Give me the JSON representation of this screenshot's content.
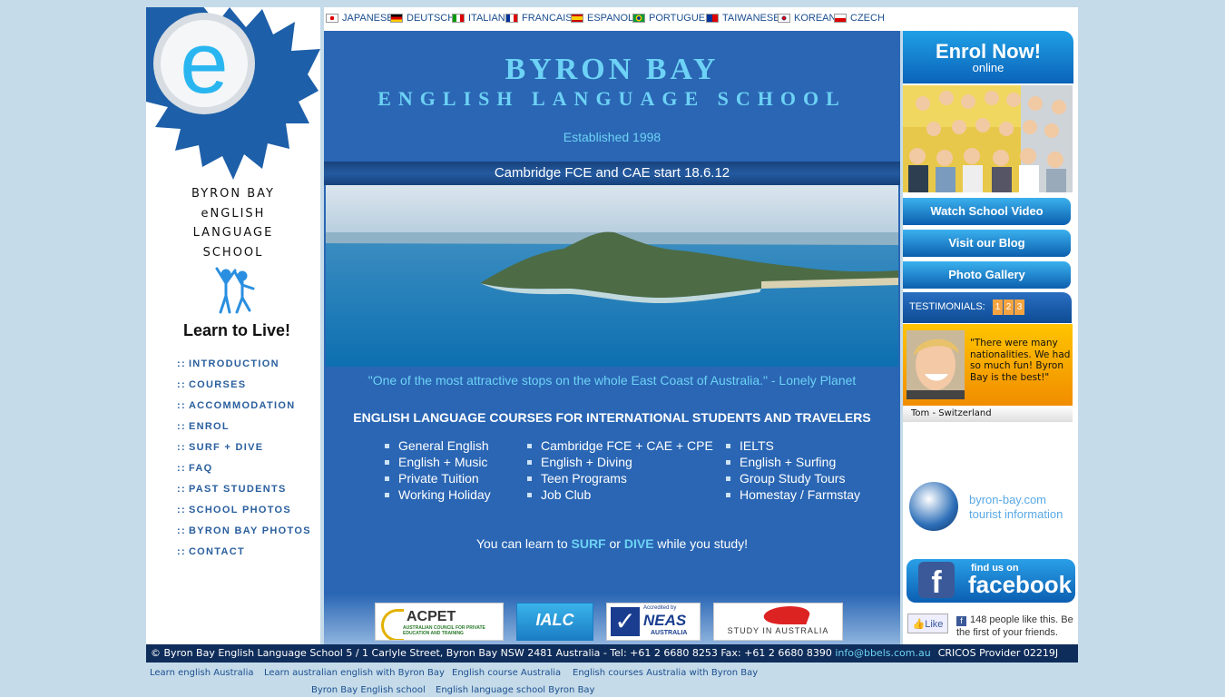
{
  "colors": {
    "accent": "#2a66b4",
    "title": "#6dd2f5",
    "nav": "#2a5f9e",
    "background": "#c5dbe9",
    "footer": "#0f2d5a"
  },
  "logo": {
    "name_lines": [
      "BYRON BAY",
      "eNGLISH",
      "LANGUAGE",
      "SCHOOL"
    ],
    "tagline": "Learn to Live!"
  },
  "nav": {
    "prefix": "::",
    "items": [
      "INTRODUCTION",
      "COURSES",
      "ACCOMMODATION",
      "ENROL",
      "SURF + DIVE",
      "FAQ",
      "PAST STUDENTS",
      "SCHOOL PHOTOS",
      "BYRON BAY PHOTOS",
      "CONTACT"
    ]
  },
  "languages": [
    {
      "label": "JAPANESE",
      "flag": "japan-flag-icon"
    },
    {
      "label": "DEUTSCH",
      "flag": "germany-flag-icon"
    },
    {
      "label": "ITALIAN",
      "flag": "italy-flag-icon"
    },
    {
      "label": "FRANCAIS",
      "flag": "france-flag-icon"
    },
    {
      "label": "ESPANOL",
      "flag": "spain-flag-icon"
    },
    {
      "label": "PORTUGUES",
      "flag": "brazil-flag-icon"
    },
    {
      "label": "TAIWANESE",
      "flag": "taiwan-flag-icon"
    },
    {
      "label": "KOREAN",
      "flag": "korea-flag-icon"
    },
    {
      "label": "CZECH",
      "flag": "czech-flag-icon"
    }
  ],
  "main": {
    "title": "BYRON BAY",
    "subtitle": "ENGLISH LANGUAGE SCHOOL",
    "established": "Established 1998",
    "banner": "Cambridge FCE and CAE start 18.6.12",
    "quote": "\"One of the most attractive stops on the whole East Coast of Australia.\" - Lonely Planet",
    "courses_heading": "ENGLISH LANGUAGE COURSES FOR INTERNATIONAL STUDENTS AND TRAVELERS",
    "courses_col1": [
      "General English",
      "English + Music",
      "Private Tuition",
      "Working Holiday"
    ],
    "courses_col2": [
      "Cambridge FCE + CAE + CPE",
      "English + Diving",
      "Teen Programs",
      "Job Club"
    ],
    "courses_col3": [
      "IELTS",
      "English + Surfing",
      "Group Study Tours",
      "Homestay / Farmstay"
    ],
    "surf_line": {
      "before": "You can learn to ",
      "surf": "SURF",
      "middle": " or ",
      "dive": "DIVE",
      "after": " while you study!"
    },
    "logos": {
      "acpet": "ACPET",
      "acpet_sub": "AUSTRALIAN COUNCIL FOR PRIVATE EDUCATION AND TRAINING",
      "ialc": "IALC",
      "neas_top": "Accredited by",
      "neas": "NEAS",
      "neas_sub": "AUSTRALIA",
      "study": "STUDY IN AUSTRALIA"
    }
  },
  "right": {
    "enrol": "Enrol Now!",
    "enrol_sub": "online",
    "buttons": [
      "Watch School Video",
      "Visit our Blog",
      "Photo Gallery"
    ],
    "testimonials_label": "TESTIMONIALS:",
    "testimonial_pages": [
      "1",
      "2",
      "3"
    ],
    "testimonial_quote": "\"There were many nationalities. We had so much fun! Byron Bay is the best!\"",
    "testimonial_name": "Tom - Switzerland",
    "tourist_line1": "byron-bay.com",
    "tourist_line2": "tourist information",
    "fb_find": "find us on",
    "fb_word": "facebook",
    "like_button": "Like",
    "like_text": "148 people like this. Be the first of your friends."
  },
  "footer": {
    "text": "© Byron Bay English Language School 5 / 1 Carlyle Street, Byron Bay NSW 2481 Australia - Tel: +61 2 6680 8253 Fax: +61 2 6680 8390 ",
    "email": "info@bbels.com.au",
    "cricos": "CRICOS Provider 02219J"
  },
  "seo_links": [
    "Learn english Australia",
    "Learn australian english with Byron Bay",
    "English course Australia",
    "English courses Australia with Byron Bay",
    "Byron Bay English school",
    "English language school Byron Bay"
  ]
}
